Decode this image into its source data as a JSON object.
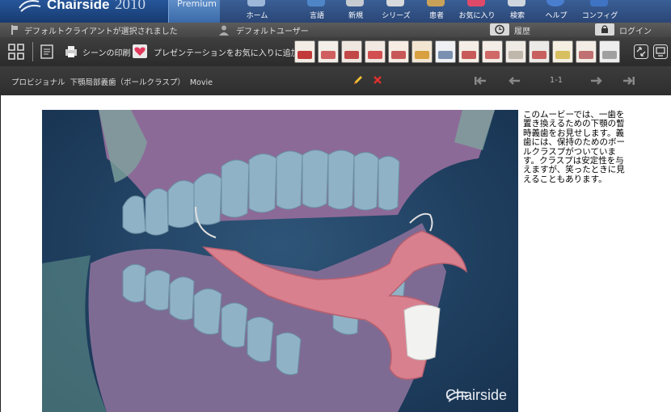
{
  "app": {
    "brand_name": "Chairside",
    "brand_year": "2010",
    "edition": "Premium"
  },
  "nav": {
    "items": [
      {
        "label": "ホーム",
        "icon": "home-icon"
      },
      {
        "label": "言語",
        "icon": "language-icon"
      },
      {
        "label": "新規",
        "icon": "new-icon"
      },
      {
        "label": "シリーズ",
        "icon": "series-icon"
      },
      {
        "label": "患者",
        "icon": "patient-icon"
      },
      {
        "label": "お気に入り",
        "icon": "favorites-icon"
      },
      {
        "label": "検索",
        "icon": "search-icon"
      },
      {
        "label": "ヘルプ",
        "icon": "help-icon"
      },
      {
        "label": "コンフィグ",
        "icon": "config-icon"
      }
    ]
  },
  "status": {
    "client": "デフォルトクライアントが選択されました",
    "user": "デフォルトユーザー",
    "history": "履歴",
    "login": "ログイン"
  },
  "toolbar": {
    "print_label": "シーンの印刷",
    "favorite_label": "プレゼンテーションをお気に入りに追加"
  },
  "title": {
    "category": "プロビジョナル",
    "name": "下顎局部義歯（ボールクラスプ）",
    "type": "Movie"
  },
  "pagination": {
    "label": "1-1"
  },
  "content": {
    "watermark": "Chairside",
    "description": "このムービーでは、一歯を置き換えるための下顎の暫時義歯をお見せします。義歯には、保持のためのボールクラスプがついています。クラスプは安定性を与えますが、笑ったときに見えることもあります。"
  },
  "colors": {
    "gum": "#8a5f8f",
    "tooth": "#8fb3c8",
    "denture": "#d97f92",
    "background": "#1f3f60"
  }
}
